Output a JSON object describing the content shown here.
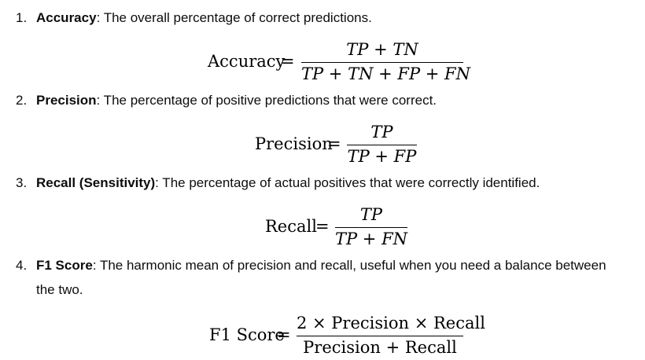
{
  "items": [
    {
      "number": "1.",
      "term": "Accuracy",
      "description": ": The overall percentage of correct predictions.",
      "formula": {
        "lhs": "Accuracy",
        "equals": "=",
        "numerator": "TP + TN",
        "denominator": "TP + TN + FP + FN"
      }
    },
    {
      "number": "2.",
      "term": "Precision",
      "description": ": The percentage of positive predictions that were correct.",
      "formula": {
        "lhs": "Precision",
        "equals": "=",
        "numerator": "TP",
        "denominator": "TP + FP"
      }
    },
    {
      "number": "3.",
      "term": "Recall (Sensitivity)",
      "description": ": The percentage of actual positives that were correctly identified.",
      "formula": {
        "lhs": "Recall",
        "equals": "=",
        "numerator": "TP",
        "denominator": "TP + FN"
      }
    },
    {
      "number": "4.",
      "term": "F1 Score",
      "description": ": The harmonic mean of precision and recall, useful when you need a balance between the two.",
      "formula": {
        "lhs": "F1 Score",
        "equals": "=",
        "numerator": "2 × Precision × Recall",
        "denominator": "Precision + Recall"
      }
    }
  ]
}
